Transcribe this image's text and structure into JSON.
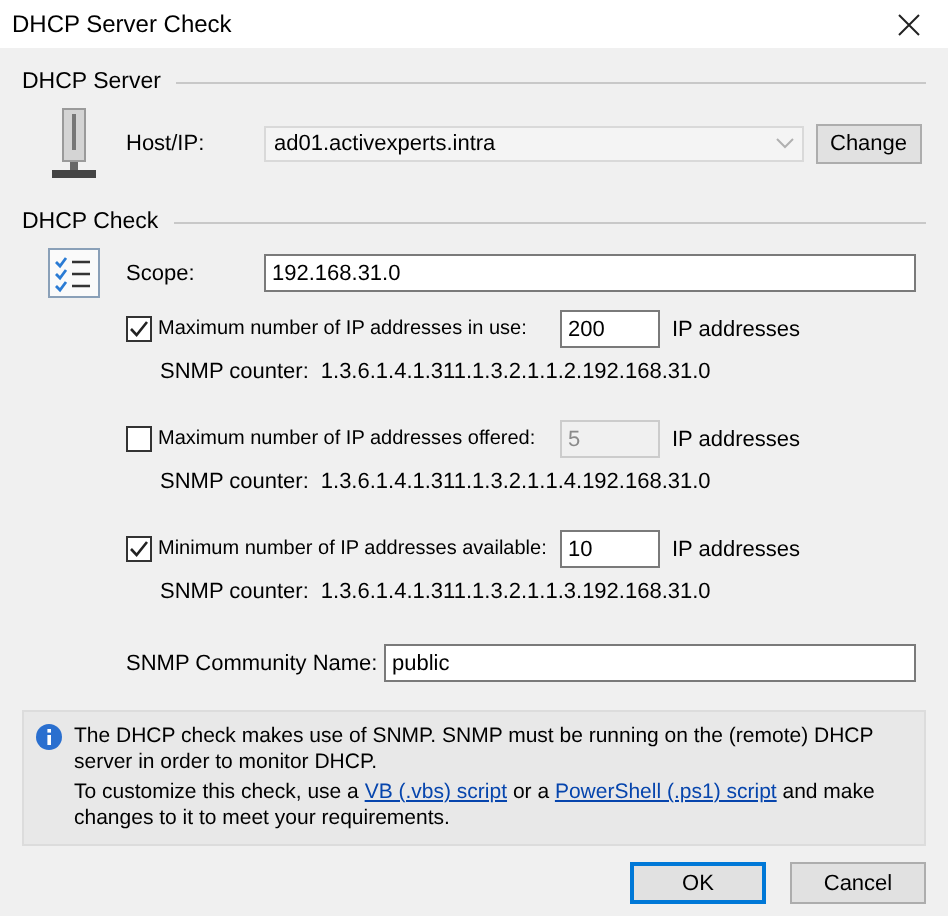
{
  "window": {
    "title": "DHCP Server Check"
  },
  "server": {
    "legend": "DHCP Server",
    "host_label": "Host/IP:",
    "host_value": "ad01.activexperts.intra",
    "change_button": "Change"
  },
  "check": {
    "legend": "DHCP Check",
    "scope_label": "Scope:",
    "scope_value": "192.168.31.0",
    "thresholds": [
      {
        "label": "Maximum number of IP addresses in use:",
        "checked": true,
        "value": "200",
        "unit": "IP addresses",
        "counter_label": "SNMP counter:",
        "counter_value": "1.3.6.1.4.1.311.1.3.2.1.1.2.192.168.31.0"
      },
      {
        "label": "Maximum number of IP addresses offered:",
        "checked": false,
        "value": "5",
        "unit": "IP addresses",
        "counter_label": "SNMP counter:",
        "counter_value": "1.3.6.1.4.1.311.1.3.2.1.1.4.192.168.31.0"
      },
      {
        "label": "Minimum number of IP addresses available:",
        "checked": true,
        "value": "10",
        "unit": "IP addresses",
        "counter_label": "SNMP counter:",
        "counter_value": "1.3.6.1.4.1.311.1.3.2.1.1.3.192.168.31.0"
      }
    ],
    "community_label": "SNMP Community Name:",
    "community_value": "public"
  },
  "info": {
    "note": "The DHCP check makes use of SNMP. SNMP must be running on the (remote) DHCP server in order to monitor DHCP.",
    "customize": [
      {
        "kind": "text",
        "text": "To customize this check, use a"
      },
      {
        "kind": "link",
        "text": "VB (.vbs) script"
      },
      {
        "kind": "text",
        "text": "or a"
      },
      {
        "kind": "link",
        "text": "PowerShell (.ps1) script"
      },
      {
        "kind": "text",
        "text": "and make changes to it to meet your requirements."
      }
    ]
  },
  "buttons": [
    {
      "label": "OK",
      "default": true
    },
    {
      "label": "Cancel",
      "default": false
    }
  ]
}
